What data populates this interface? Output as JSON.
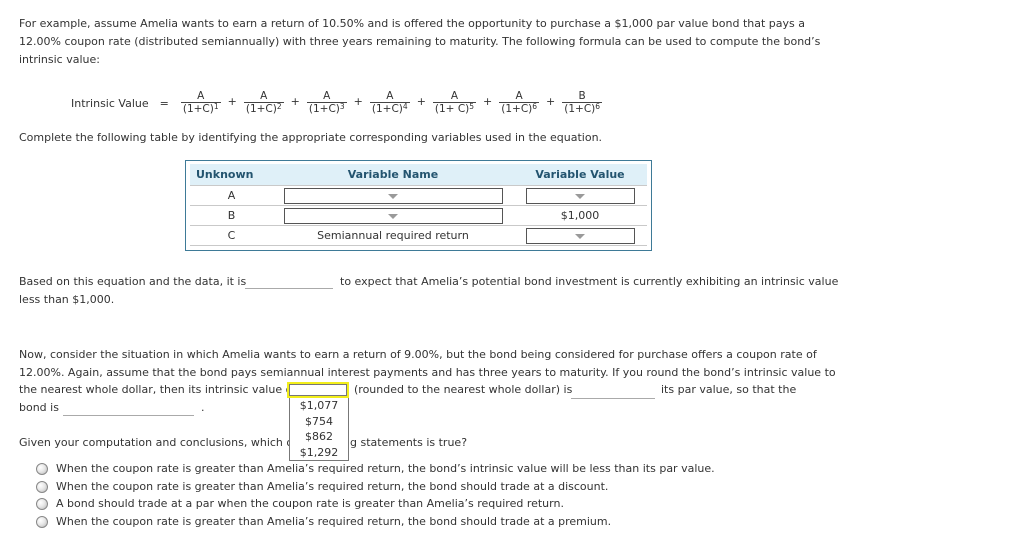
{
  "intro": {
    "line1": "For example, assume Amelia wants to earn a return of 10.50% and is offered the opportunity to purchase a $1,000 par value bond that pays a",
    "line2": "12.00% coupon rate (distributed semiannually) with three years remaining to maturity. The following formula can be used to compute the bond’s",
    "line3": "intrinsic value:"
  },
  "formula": {
    "label": "Intrinsic Value",
    "equals": "=",
    "plus": "+",
    "terms": [
      {
        "num": "A",
        "den": "(1+C)",
        "exp": "1"
      },
      {
        "num": "A",
        "den": "(1+C)",
        "exp": "2"
      },
      {
        "num": "A",
        "den": "(1+C)",
        "exp": "3"
      },
      {
        "num": "A",
        "den": "(1+C)",
        "exp": "4"
      },
      {
        "num": "A",
        "den": "(1+ C)",
        "exp": "5"
      },
      {
        "num": "A",
        "den": "(1+C)",
        "exp": "6"
      },
      {
        "num": "B",
        "den": "(1+C)",
        "exp": "6"
      }
    ]
  },
  "instruction": "Complete the following table by identifying the appropriate corresponding variables used in the equation.",
  "table": {
    "headers": [
      "Unknown",
      "Variable Name",
      "Variable Value"
    ],
    "rows": [
      {
        "unknown": "A",
        "name": "",
        "value": ""
      },
      {
        "unknown": "B",
        "name": "",
        "value": "$1,000"
      },
      {
        "unknown": "C",
        "name": "Semiannual required return",
        "value": ""
      }
    ]
  },
  "q1": {
    "before": "Based on this equation and the data, it is",
    "after": "to expect that Amelia’s potential bond investment is currently exhibiting an intrinsic value",
    "line2": "less than $1,000.",
    "blank_value": ""
  },
  "q2": {
    "line1": "Now, consider the situation in which Amelia wants to earn a return of 9.00%, but the bond being considered for purchase offers a coupon rate of",
    "line2": "12.00%. Again, assume that the bond pays semiannual interest payments and has three years to maturity. If you round the bond’s intrinsic value to",
    "line3_before": "the nearest whole dollar, then its intrinsic value of",
    "line3_mid": "(rounded to the nearest whole dollar) is",
    "line3_after": "its par value, so that the",
    "line4_before": "bond is",
    "line4_after": ".",
    "dropdown": {
      "selected": "",
      "options": [
        "$1,077",
        "$754",
        "$862",
        "$1,292"
      ]
    }
  },
  "q3": {
    "before": "Given your computation and conclusions, which of",
    "after": "g statements is true?",
    "options": [
      "When the coupon rate is greater than Amelia’s required return, the bond’s intrinsic value will be less than its par value.",
      "When the coupon rate is greater than Amelia’s required return, the bond should trade at a discount.",
      "A bond should trade at a par when the coupon rate is greater than Amelia’s required return.",
      "When the coupon rate is greater than Amelia’s required return, the bond should trade at a premium."
    ]
  },
  "colors": {
    "table_border": "#3e7a97",
    "table_header_bg": "#dff0f8",
    "table_header_text": "#23546f",
    "focus_highlight": "#f2ee1a"
  }
}
